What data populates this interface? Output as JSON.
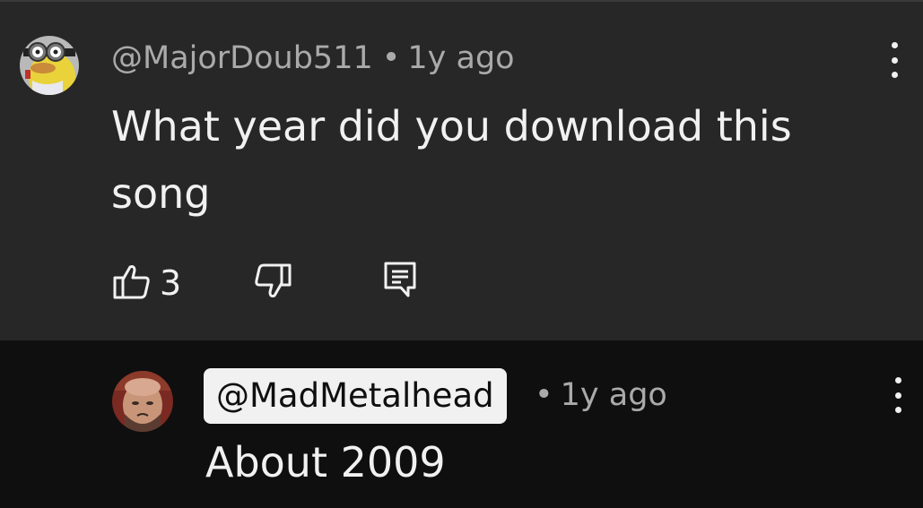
{
  "comment": {
    "author": "@MajorDoub511",
    "separator": "•",
    "timestamp": "1y ago",
    "text": "What year did you download this song",
    "like_count": "3",
    "avatar_icon": "minion-avatar",
    "like_icon": "thumbs-up-icon",
    "dislike_icon": "thumbs-down-icon",
    "reply_icon": "reply-comment-icon",
    "more_icon": "more-vertical-icon"
  },
  "reply": {
    "author": "@MadMetalhead",
    "separator": "•",
    "timestamp": "1y ago",
    "text": "About 2009",
    "avatar_icon": "person-avatar",
    "more_icon": "more-vertical-icon"
  },
  "colors": {
    "comment_background": "#272727",
    "page_background": "#0f0f0f",
    "primary_text": "#f1f1f1",
    "secondary_text": "#aaaaaa",
    "highlight_pill": "#f1f1f1"
  }
}
